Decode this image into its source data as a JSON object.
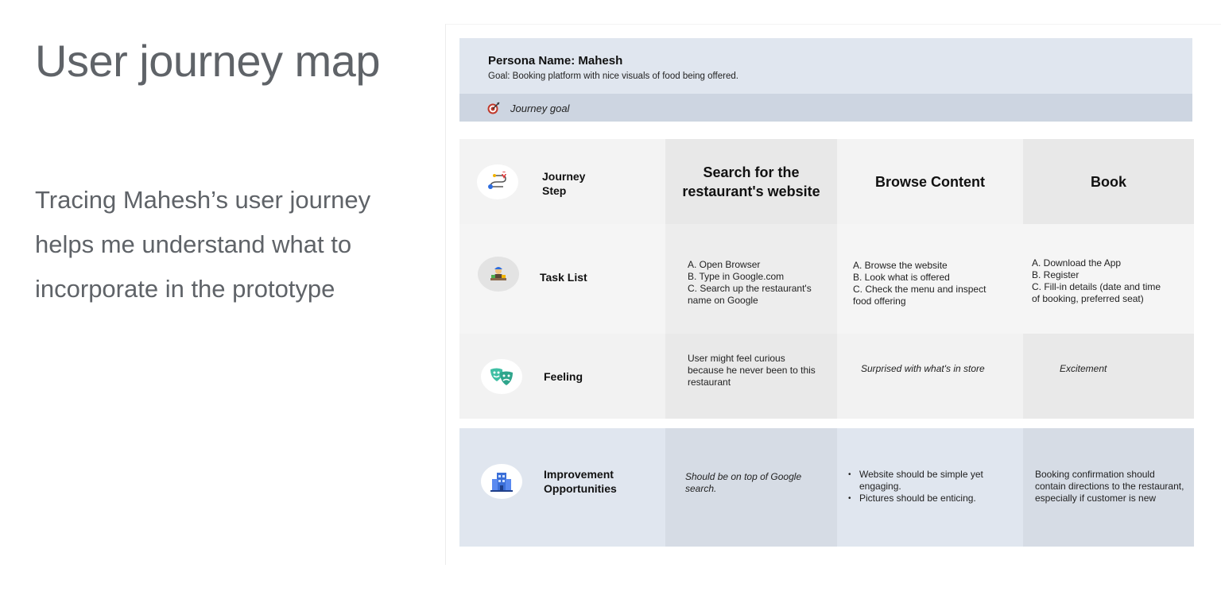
{
  "slide": {
    "title": "User journey map",
    "body": "Tracing Mahesh’s user journey helps me understand what to incorporate in the prototype"
  },
  "persona": {
    "name": "Persona Name: Mahesh",
    "goal": "Goal: Booking platform with nice visuals of food being offered."
  },
  "journey_goal": {
    "label": "Journey goal",
    "icon": "target-icon"
  },
  "rows": {
    "steps": {
      "label_line1": "Journey",
      "label_line2": "Step",
      "icon": "route-icon",
      "cells": [
        "Search for the restaurant's website",
        "Browse Content",
        "Book"
      ]
    },
    "tasks": {
      "label": "Task List",
      "icon": "person-at-desk-icon",
      "cells": [
        [
          "A. Open Browser",
          "B. Type in Google.com",
          "C. Search up the restaurant's",
          "name on Google"
        ],
        [
          "A. Browse the website",
          "B. Look what is offered",
          "C. Check the menu and inspect",
          "food offering"
        ],
        [
          "A. Download the App",
          "B. Register",
          "C. Fill-in details (date and time",
          "of booking, preferred seat)"
        ]
      ]
    },
    "feeling": {
      "label": "Feeling",
      "icon": "theater-masks-icon",
      "cells": [
        "User might feel curious because he never been to this restaurant",
        "Surprised with what's in store",
        "Excitement"
      ]
    },
    "improvement": {
      "label_line1": "Improvement",
      "label_line2": "Opportunities",
      "icon": "building-icon",
      "cells": {
        "c1": "Should be on top of Google search.",
        "c2": [
          "Website should be simple yet engaging.",
          "Pictures should be enticing."
        ],
        "c3": "Booking confirmation should contain directions to the restaurant, especially if customer is new"
      }
    }
  },
  "colors": {
    "persona_bg": "#e0e6ef",
    "journey_goal_bg": "#cdd5e1",
    "improvement_bg": "#e0e6ef",
    "heading_text": "#5f6368"
  }
}
